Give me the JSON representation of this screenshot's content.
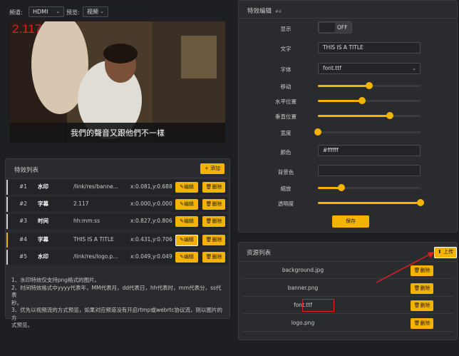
{
  "top": {
    "channel_label": "频道:",
    "channel_value": "HDMI",
    "preview_label": "预览:",
    "preview_value": "视频"
  },
  "video": {
    "overlay_text": "2.117",
    "subtitle": "我們的聲音又跟他們不一樣"
  },
  "effects": {
    "title": "特效列表",
    "add_label": "+ 添加",
    "edit_label": "编辑",
    "delete_label": "删除",
    "rows": [
      {
        "num": "#1",
        "type": "水印",
        "content": "/link/res/banne...",
        "pos": "x:0.081,y:0.688"
      },
      {
        "num": "#2",
        "type": "字幕",
        "content": "2.117",
        "pos": "x:0.000,y:0.000"
      },
      {
        "num": "#3",
        "type": "时间",
        "content": "hh:mm:ss",
        "pos": "x:0.827,y:0.806"
      },
      {
        "num": "#4",
        "type": "字幕",
        "content": "THIS IS A TITLE",
        "pos": "x:0.431,y:0.706"
      },
      {
        "num": "#5",
        "type": "水印",
        "content": "/link/res/logo.p...",
        "pos": "x:0.049,y:0.049"
      }
    ],
    "notes": [
      "1、水印特效仅支持png格式的图片。",
      "2、时间特效格式中yyyy代表年，MM代表月，dd代表日，hh代表时，mm代表分，ss代表",
      "秒。",
      "3、优先以视频流的方式预览，如果对应频道没有开启rtmp或webrtc协议流，则以图片的方",
      "式预览。"
    ]
  },
  "editor": {
    "title": "特效编辑",
    "badge": "#4",
    "labels": {
      "show": "显示",
      "text": "文字",
      "font": "字体",
      "move": "移动",
      "hpos": "水平位置",
      "vpos": "垂直位置",
      "width": "宽度",
      "color": "颜色",
      "bgcolor": "背景色",
      "scale": "缩放",
      "opacity": "透明度"
    },
    "toggle_text": "OFF",
    "text_value": "THIS IS A TITLE",
    "font_value": "font.ttf",
    "color_value": "#ffffff",
    "bgcolor_value": "",
    "save_label": "保存",
    "sliders": {
      "move": 0.5,
      "hpos": 0.43,
      "vpos": 0.7,
      "width": 0.0,
      "scale": 0.23,
      "opacity": 1.0
    }
  },
  "resources": {
    "title": "资源列表",
    "upload_label": "上传",
    "delete_label": "删除",
    "items": [
      "background.jpg",
      "banner.png",
      "font.ttf",
      "logo.png"
    ]
  },
  "colors": {
    "accent": "#f5b301",
    "highlight_red": "#e02020",
    "arrow": "#e02020"
  }
}
